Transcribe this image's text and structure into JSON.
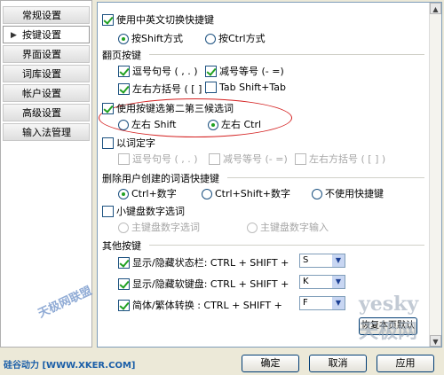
{
  "sidebar": {
    "items": [
      {
        "label": "常规设置"
      },
      {
        "label": "按键设置",
        "active": true
      },
      {
        "label": "界面设置"
      },
      {
        "label": "词库设置"
      },
      {
        "label": "帐户设置"
      },
      {
        "label": "高级设置"
      },
      {
        "label": "输入法管理"
      }
    ]
  },
  "switch_hotkey": {
    "label": "使用中英文切换快捷键",
    "checked": true,
    "opt_shift": "按Shift方式",
    "opt_ctrl": "按Ctrl方式",
    "selected": "shift"
  },
  "page_flip": {
    "title": "翻页按键",
    "comma_period": "逗号句号 ( , . )",
    "minus_equal": "减号等号 (- =)",
    "brackets": "左右方括号 ( [ ] )",
    "tab": "Tab Shift+Tab"
  },
  "candidate_keys": {
    "label": "使用按键选第二第三候选词",
    "checked": true,
    "opt_shift": "左右 Shift",
    "opt_ctrl": "左右 Ctrl",
    "selected": "ctrl"
  },
  "word_select": {
    "label": "以词定字",
    "checked": false,
    "comma_period": "逗号句号 ( , . )",
    "minus_equal": "减号等号 (- =)",
    "brackets": "左右方括号 ( [ ] )"
  },
  "delete_word": {
    "title": "删除用户创建的词语快捷键",
    "opt1": "Ctrl+数字",
    "opt2": "Ctrl+Shift+数字",
    "opt3": "不使用快捷键",
    "selected": "opt1"
  },
  "numpad": {
    "label": "小键盘数字选词",
    "checked": false,
    "opt1": "主键盘数字选词",
    "opt2": "主键盘数字输入"
  },
  "other_keys": {
    "title": "其他按键",
    "rows": [
      {
        "label": "显示/隐藏状态栏: CTRL + SHIFT +",
        "key": "S",
        "checked": true
      },
      {
        "label": "显示/隐藏软键盘: CTRL + SHIFT +",
        "key": "K",
        "checked": true
      },
      {
        "label": "简体/繁体转换  : CTRL + SHIFT +",
        "key": "F",
        "checked": true
      }
    ]
  },
  "restore_button": "恢复本页默认",
  "buttons": {
    "ok": "确定",
    "cancel": "取消",
    "apply": "应用"
  },
  "watermarks": {
    "bottom_left": "硅谷动力 [WWW.XKER.COM]",
    "logo": "天极网联盟",
    "right": "yesky 天极网"
  },
  "colors": {
    "check_green": "#21a121",
    "annotation_red": "#d42020",
    "border_blue": "#7f9db9"
  }
}
